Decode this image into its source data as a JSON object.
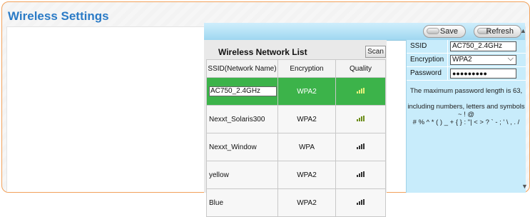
{
  "page": {
    "title": "Wireless Settings"
  },
  "toolbar": {
    "save_label": "Save",
    "refresh_label": "Refresh"
  },
  "list": {
    "title": "Wireless Network List",
    "scan_label": "Scan",
    "columns": [
      "SSID(Network Name)",
      "Encryption",
      "Quality"
    ],
    "rows": [
      {
        "ssid": "AC750_2.4GHz",
        "encryption": "WPA2",
        "quality": "signal-strong-icon",
        "selected": true
      },
      {
        "ssid": "Nexxt_Solaris300",
        "encryption": "WPA2",
        "quality": "signal-strong-icon",
        "selected": false
      },
      {
        "ssid": "Nexxt_Window",
        "encryption": "WPA",
        "quality": "signal-icon",
        "selected": false
      },
      {
        "ssid": "yellow",
        "encryption": "WPA2",
        "quality": "signal-icon",
        "selected": false
      },
      {
        "ssid": "Blue",
        "encryption": "WPA2",
        "quality": "signal-icon",
        "selected": false
      }
    ]
  },
  "form": {
    "ssid_label": "SSID",
    "ssid_value": "AC750_2.4GHz",
    "encryption_label": "Encryption",
    "encryption_value": "WPA2",
    "password_label": "Password",
    "password_value": "●●●●●●●●●",
    "hint_line1": "The maximum password length is 63,",
    "hint_line2": "including numbers, letters and symbols ~ ! @",
    "hint_line3": "# % ^ * ( ) _ + { } : \"| < > ? ` - ; ' \\ , . /"
  },
  "colors": {
    "accent": "#2b7bc6",
    "selected_row": "#3cb34a",
    "form_panel": "#c8ecfb",
    "border_orange": "#f2a15a"
  }
}
